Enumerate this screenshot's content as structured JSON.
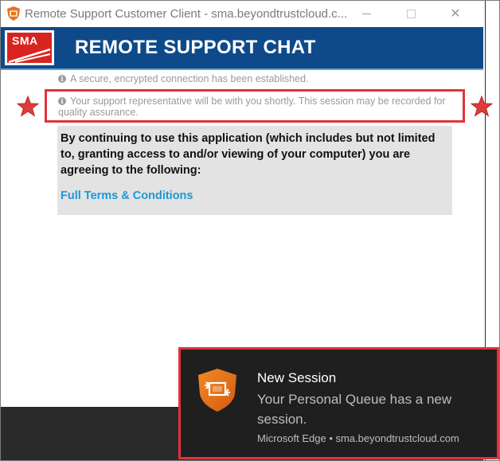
{
  "window": {
    "title": "Remote Support Customer Client - sma.beyondtrustcloud.c...",
    "close_glyph": "✕"
  },
  "banner": {
    "logo_text": "SMA",
    "title": "REMOTE SUPPORT CHAT",
    "color": "#0e4a8a"
  },
  "chat": {
    "messages": [
      "A secure, encrypted connection has been established.",
      "Your support representative will be with you shortly. This session may be recorded for quality assurance."
    ],
    "info_icon": "i"
  },
  "terms": {
    "text": "By continuing to use this application (which includes but not limited to, granting access to and/or viewing of your computer) you are agreeing to the following:",
    "link_label": "Full Terms & Conditions",
    "link_color": "#1a9ad6"
  },
  "toast": {
    "title": "New Session",
    "body": "Your Personal Queue has a new session.",
    "source": "Microsoft Edge • sma.beyondtrustcloud.com",
    "icon": "remote-session-shield-icon"
  },
  "annotations": {
    "highlight_color": "#e0333b",
    "star_icon": "star-icon"
  }
}
